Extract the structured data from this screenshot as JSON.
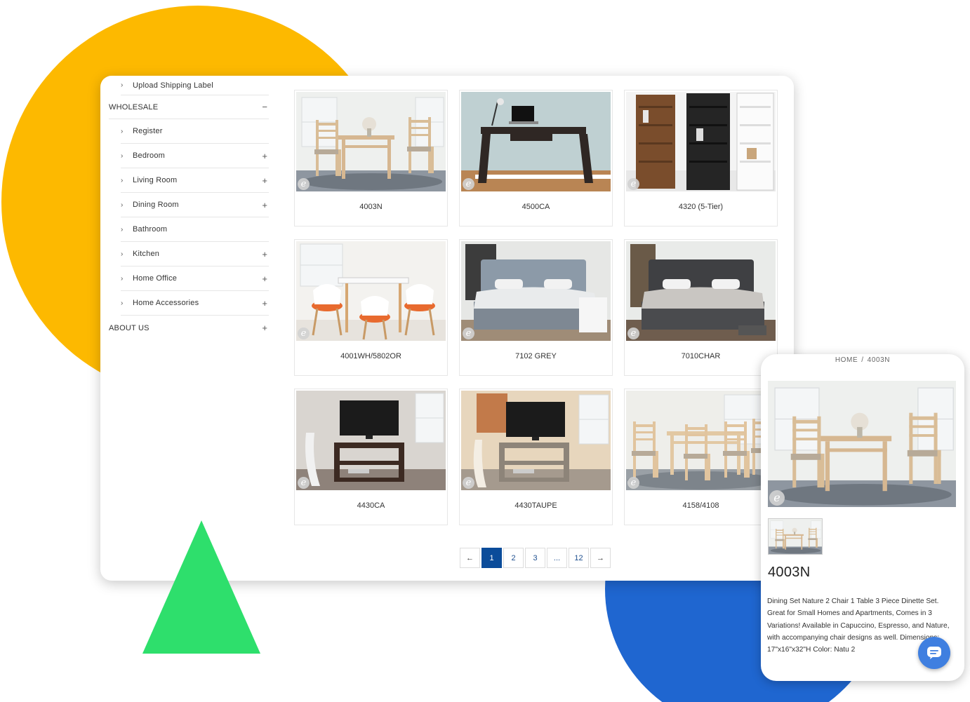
{
  "sidebar": {
    "upload_label": "Upload Shipping Label",
    "wholesale": {
      "label": "WHOLESALE",
      "toggle": "−"
    },
    "items": [
      {
        "label": "Register",
        "plus": ""
      },
      {
        "label": "Bedroom",
        "plus": "+"
      },
      {
        "label": "Living Room",
        "plus": "+"
      },
      {
        "label": "Dining Room",
        "plus": "+"
      },
      {
        "label": "Bathroom",
        "plus": ""
      },
      {
        "label": "Kitchen",
        "plus": "+"
      },
      {
        "label": "Home Office",
        "plus": "+"
      },
      {
        "label": "Home Accessories",
        "plus": "+"
      }
    ],
    "about": {
      "label": "ABOUT US",
      "toggle": "+"
    },
    "chevron": "›"
  },
  "products": [
    {
      "label": "4003N",
      "scene": "dinette"
    },
    {
      "label": "4500CA",
      "scene": "desk"
    },
    {
      "label": "4320 (5-Tier)",
      "scene": "bookcase"
    },
    {
      "label": "4001WH/5802OR",
      "scene": "dining-white"
    },
    {
      "label": "7102 GREY",
      "scene": "bed-grey"
    },
    {
      "label": "7010CHAR",
      "scene": "bed-char"
    },
    {
      "label": "4430CA",
      "scene": "tv-dark"
    },
    {
      "label": "4430TAUPE",
      "scene": "tv-taupe"
    },
    {
      "label": "4158/4108",
      "scene": "dining-table"
    }
  ],
  "pagination": {
    "prev": "←",
    "pages": [
      "1",
      "2",
      "3",
      "...",
      "12"
    ],
    "active": "1",
    "next": "→"
  },
  "mobile": {
    "breadcrumb": {
      "home": "HOME",
      "separator": "/",
      "current": "4003N"
    },
    "title": "4003N",
    "description": "Dining Set Nature 2 Chair 1 Table 3 Piece Dinette Set. Great for Small Homes and Apartments, Comes in 3 Variations! Available in Capuccino, Espresso, and Nature, with accompanying chair designs as well.  Dimensions: 17\"x16\"x32\"H Color: Natu         2"
  },
  "watermark_glyph": "e",
  "colors": {
    "yellow_blob": "#FDB900",
    "blue_blob": "#1F66D0",
    "green_triangle": "#2EDF6C",
    "pager_active": "#0B4C9A",
    "chat_button": "#3F7FE0"
  }
}
